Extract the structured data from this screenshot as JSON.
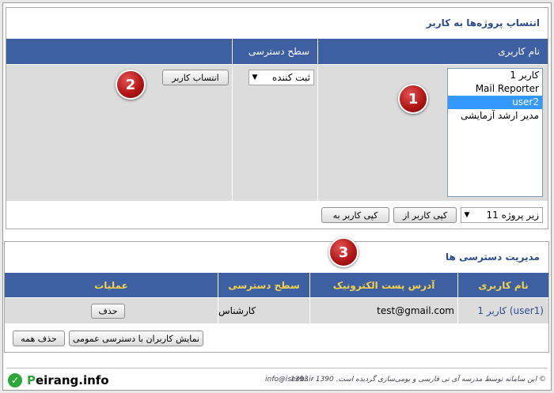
{
  "assign_panel": {
    "title": "انتساب پروژه‌ها به کاربر",
    "col_username": "نام کاربری",
    "col_access_level": "سطح دسترسی",
    "users": [
      "کاربر 1",
      "Mail Reporter",
      "user2",
      "مدیر ارشد آزمایشی"
    ],
    "selected_user": "user2",
    "access_select_value": "ثبت کننده",
    "assign_button": "انتساب کاربر",
    "subproject_select_value": "زیر پروژه 11",
    "copy_from_button": "کپی کاربر از",
    "copy_to_button": "کپی کاربر به"
  },
  "access_panel": {
    "title": "مدیریت دسترسی ها",
    "headers": {
      "username": "نام کاربری",
      "email": "آدرس پست الکترونیک",
      "access_level": "سطح دسترسی",
      "actions": "عملیات"
    },
    "rows": [
      {
        "username": "کاربر 1 (user1)",
        "email": "test@gmail.com",
        "access_level": "کارشناس",
        "delete": "حذف"
      }
    ],
    "show_public_button": "نمایش کاربران با دسترسی عمومی",
    "delete_all_button": "حذف همه"
  },
  "badges": [
    "1",
    "2",
    "3"
  ],
  "footer": {
    "copyright": "© این سامانه توسط مدرسه آی تی فارسی و بومی‌سازی گردیده است. 1390 - 1393",
    "email": "info@iseebi.ir",
    "logo_first": "P",
    "logo_rest": "eirang.info"
  },
  "colors": {
    "header_blue": "#3f5fa3",
    "title_blue": "#2c4b8f",
    "header_yellow": "#f2d34a",
    "badge_red": "#b31616",
    "selected_blue": "#3399ff",
    "logo_green": "#2ea63a"
  }
}
